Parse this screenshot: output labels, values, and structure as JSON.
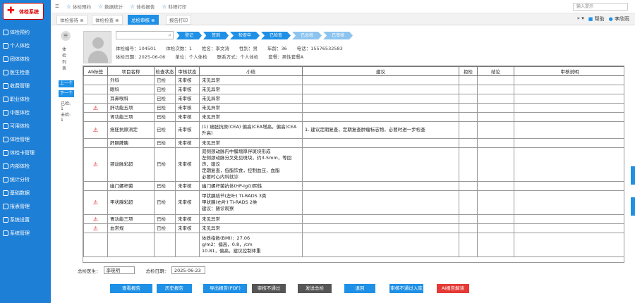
{
  "brand": {
    "mark": "✚",
    "text": "体检系统"
  },
  "sidebar": {
    "items": [
      {
        "label": "体检预约"
      },
      {
        "label": "个人体检"
      },
      {
        "label": "团体体检"
      },
      {
        "label": "医生检查"
      },
      {
        "label": "收费管理"
      },
      {
        "label": "职业体检"
      },
      {
        "label": "中医体检"
      },
      {
        "label": "可用体检"
      },
      {
        "label": "体检管理"
      },
      {
        "label": "体检卡管理"
      },
      {
        "label": "内部体检"
      },
      {
        "label": "统计分析"
      },
      {
        "label": "基础数据"
      },
      {
        "label": "报表管理"
      },
      {
        "label": "系统设置"
      },
      {
        "label": "系统管理"
      }
    ]
  },
  "topnav": {
    "items": [
      {
        "label": "体检预约"
      },
      {
        "label": "数据统计"
      },
      {
        "label": "体检报告"
      },
      {
        "label": "科研打印"
      }
    ]
  },
  "header_right": {
    "search": "输入提示",
    "help": "帮助",
    "user": "李欣雨"
  },
  "tabs": [
    {
      "label": "体检接待 ⊗"
    },
    {
      "label": "体检检查 ⊗"
    },
    {
      "label": "总检审核 ⊗"
    },
    {
      "label": "报告打印"
    }
  ],
  "steps": [
    {
      "label": "登记"
    },
    {
      "label": "签到"
    },
    {
      "label": "检查中"
    },
    {
      "label": "已检查"
    },
    {
      "label": "已总检"
    },
    {
      "label": "已审核"
    }
  ],
  "patient": {
    "row1": [
      {
        "label": "体检编号：",
        "value": "104501"
      },
      {
        "label": "体检次数：",
        "value": "1"
      },
      {
        "label": "姓名：",
        "value": "李文涛"
      },
      {
        "label": "性别：",
        "value": "男"
      },
      {
        "label": "年龄：",
        "value": "36"
      },
      {
        "label": "电话：",
        "value": "15576532583"
      }
    ],
    "row2": [
      {
        "label": "体检日期：",
        "value": "2025-06-06"
      },
      {
        "label": "单位：",
        "value": "个人体检"
      },
      {
        "label": "联系方式：",
        "value": "个人体检"
      },
      {
        "label": "套餐：",
        "value": "男性套餐A"
      }
    ]
  },
  "left_panel": {
    "circle_glyph": "☰",
    "vertical_label": "体检列表",
    "btn_prev": "上一个",
    "btn_next": "下一个",
    "stat1": "已检:1",
    "stat2": "未检:1"
  },
  "table": {
    "headers": [
      "Ab标签",
      "项目名称",
      "检查状态",
      "审核状态",
      "小结",
      "建议",
      "拒检",
      "结论",
      "审核说明"
    ],
    "rows": [
      {
        "ab": "",
        "name": "外科",
        "status": "已检",
        "review": "未审核",
        "summary": "未见异常",
        "advice": ""
      },
      {
        "ab": "",
        "name": "眼科",
        "status": "已检",
        "review": "未审核",
        "summary": "未见异常",
        "advice": ""
      },
      {
        "ab": "",
        "name": "耳鼻喉科",
        "status": "已检",
        "review": "未审核",
        "summary": "未见异常",
        "advice": ""
      },
      {
        "ab": "⚠",
        "name": "肝功能五项",
        "status": "已检",
        "review": "未审核",
        "summary": "未见异常",
        "advice": ""
      },
      {
        "ab": "",
        "name": "肾功能三项",
        "status": "已检",
        "review": "未审核",
        "summary": "未见异常",
        "advice": ""
      },
      {
        "ab": "⚠",
        "name": "癌胚抗原测定",
        "status": "已检",
        "review": "未审核",
        "summary": "(1) 癌胚抗原(CEA) 偏高(CEA增高，偏高(CEA升高)",
        "advice": "1. 建议定期复查，定期复查肿瘤标志物，必要时进一步检查"
      },
      {
        "ab": "",
        "name": "肝胆脾胰",
        "status": "已检",
        "review": "未审核",
        "summary": "未见异常",
        "advice": ""
      },
      {
        "ab": "⚠",
        "name": "颈动脉彩超",
        "status": "已检",
        "review": "未审核",
        "summary": "双侧颈动脉内中膜增厚伴斑块形成\n左侧颈动脉分叉处见斑块，约3-5mm，等回声，建议\n定期复查，低脂饮食，控制血压，血脂\n必要时心内科就诊",
        "advice": ""
      },
      {
        "ab": "",
        "name": "幽门螺杆菌",
        "status": "已检",
        "review": "未审核",
        "summary": "幽门螺杆菌抗体(HP-IgG)阴性",
        "advice": ""
      },
      {
        "ab": "⚠",
        "name": "甲状腺彩超",
        "status": "已检",
        "review": "未审核",
        "summary": "甲状腺结节(左叶)  TI-RADS 3类\n甲状腺(右叶)  TI-RADS 2类\n建议：随诊观察",
        "advice": ""
      },
      {
        "ab": "⚠",
        "name": "胃功能三项",
        "status": "已检",
        "review": "未审核",
        "summary": "未见异常",
        "advice": ""
      },
      {
        "ab": "⚠",
        "name": "血常规",
        "status": "已检",
        "review": "未审核",
        "summary": "未见异常",
        "advice": ""
      },
      {
        "ab": "",
        "name": "",
        "status": "",
        "review": "",
        "summary": "体质指数(BMI)：27.06\ng/m2：偏高，0.8，/cm\n10.81，偏高，建议控制体重",
        "advice": ""
      }
    ]
  },
  "footer": {
    "doctor_label": "总检医生：",
    "doctor_value": "李晓明",
    "date_label": "总检日期：",
    "date_value": "2025-06-23"
  },
  "buttons": [
    {
      "label": "查看报告",
      "color": "#1e90e6"
    },
    {
      "label": "历史报告",
      "color": "#1e90e6"
    },
    {
      "label": "导出报告(PDF)",
      "color": "#1e90e6"
    },
    {
      "label": "审核不通过",
      "color": "#555555"
    },
    {
      "label": "发送总检",
      "color": "#555555"
    },
    {
      "label": "退回",
      "color": "#1e90e6"
    },
    {
      "label": "审核不通过入库",
      "color": "#1e90e6"
    },
    {
      "label": "AI报告解读",
      "color": "#e53935"
    }
  ]
}
